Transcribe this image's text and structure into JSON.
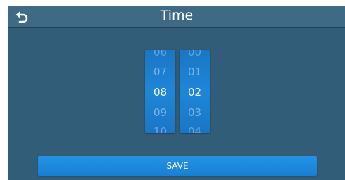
{
  "header": {
    "title": "Time",
    "back_icon": "back-arrow-icon"
  },
  "time_picker": {
    "hours": [
      "06",
      "07",
      "08",
      "09",
      "10"
    ],
    "minutes": [
      "00",
      "01",
      "02",
      "03",
      "04"
    ],
    "selected_hour": "08",
    "selected_minute": "02"
  },
  "actions": {
    "save_label": "SAVE"
  },
  "colors": {
    "screen_background": "#325d78",
    "titlebar": "#3e6a86",
    "accent": "#1e86d9"
  }
}
